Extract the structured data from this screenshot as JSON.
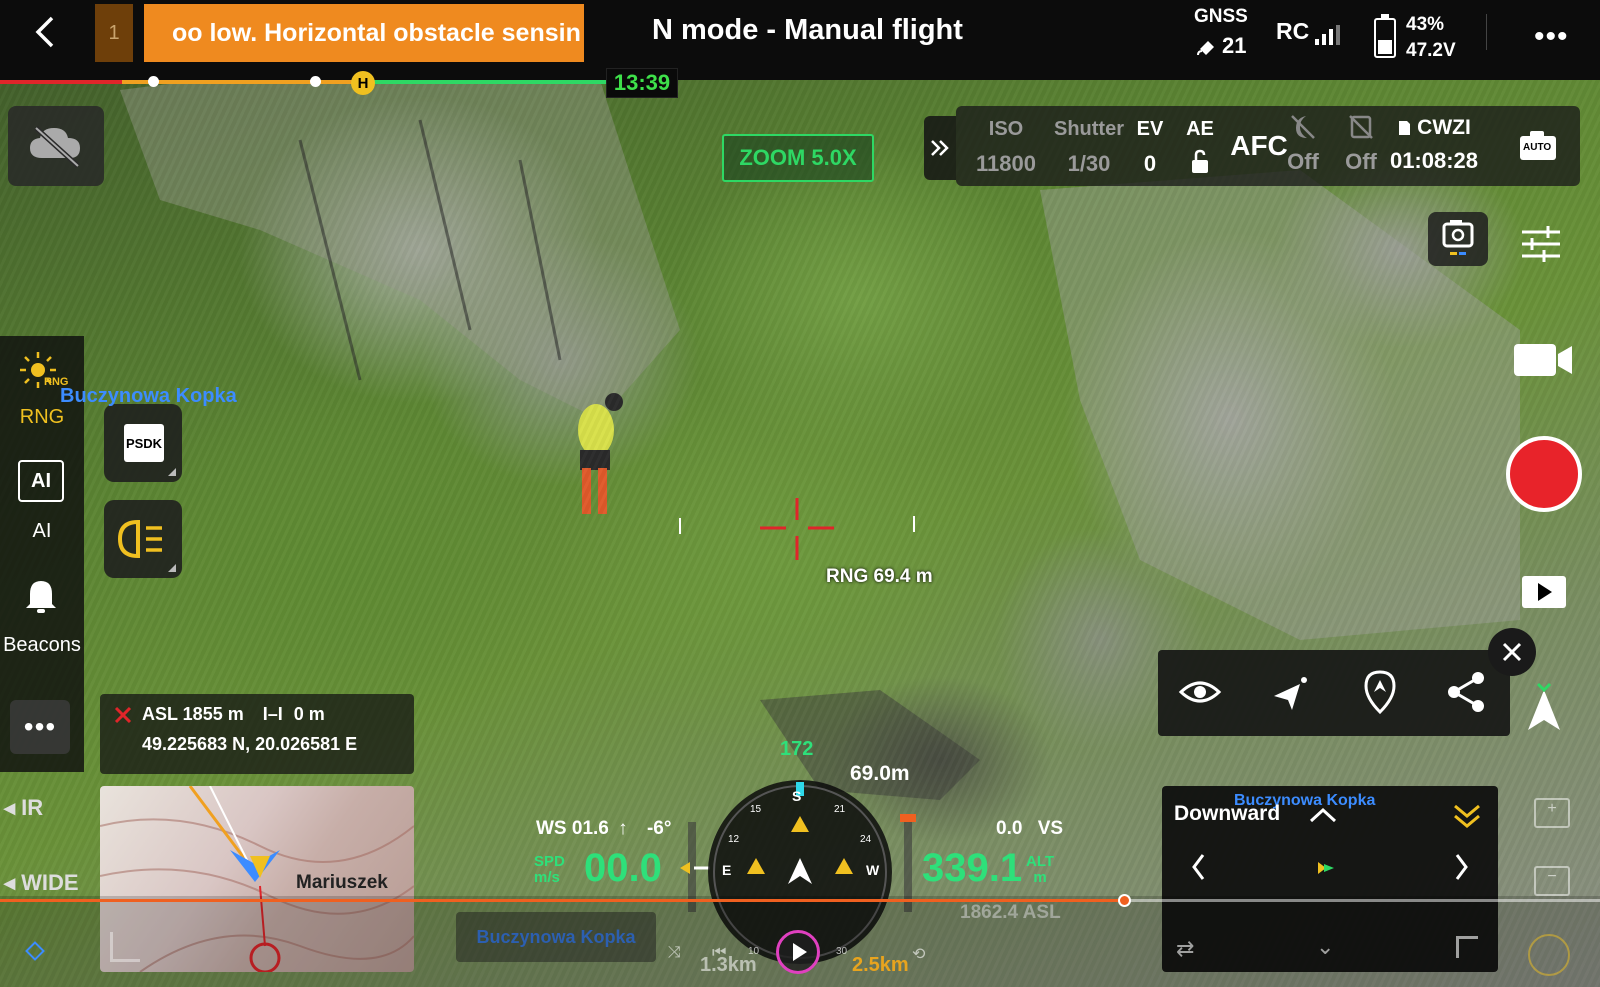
{
  "top_bar": {
    "alert_count": "1",
    "alert_text": "oo low. Horizontal obstacle sensin",
    "flight_mode": "N mode - Manual flight",
    "gnss_label": "GNSS",
    "gnss_satellites": "21",
    "rc_label": "RC",
    "battery_percent": "43%",
    "battery_voltage": "47.2V",
    "more_label": "•••",
    "flight_time": "13:39",
    "home_marker": "H"
  },
  "left_rail": {
    "rng_label": "RNG",
    "rng_icon_text": "RNG",
    "ai_icon_text": "AI",
    "ai_label": "AI",
    "beacons_label": "Beacons",
    "more_label": "•••",
    "psdk_label": "PSDK",
    "lens_ir": "IR",
    "lens_wide": "WIDE"
  },
  "map_overlay": {
    "poi_label": "Buczynowa Kopka",
    "poi_name": "Mariuszek"
  },
  "camera_params": {
    "zoom": "ZOOM  5.0X",
    "iso_label": "ISO",
    "iso_value": "11800",
    "shutter_label": "Shutter",
    "shutter_value": "1/30",
    "ev_label": "EV",
    "ev_value": "0",
    "ae_label": "AE",
    "focus_mode": "AFC",
    "param_off_1": "Off",
    "param_off_2": "Off",
    "storage_label": "CWZI",
    "storage_remaining": "01:08:28",
    "auto_label": "AUTO"
  },
  "target": {
    "range": "RNG 69.4 m"
  },
  "location": {
    "asl": "ASL 1855 m",
    "rel_height": "0 m",
    "coords": "49.225683 N, 20.026581 E"
  },
  "instruments": {
    "heading": "172",
    "distance": "69.0m",
    "wind": "WS 01.6",
    "pitch": "-6°",
    "speed_label_1": "SPD",
    "speed_label_2": "m/s",
    "speed": "00.0",
    "vs_value": "0.0",
    "vs_label": "VS",
    "altitude": "339.1",
    "alt_label_1": "ALT",
    "alt_label_2": "m",
    "asl_readout": "1862.4 ASL",
    "compass_s": "S",
    "compass_e": "E",
    "compass_w": "W",
    "tick_15": "15",
    "tick_21": "21",
    "tick_12": "12",
    "tick_24": "24"
  },
  "downward": {
    "label": "Downward",
    "poi_label": "Buczynowa Kopka"
  },
  "playback": {
    "poi_label": "Buczynowa Kopka",
    "dist_left": "1.3km",
    "dist_right": "2.5km",
    "skip_back": "10",
    "skip_fwd": "30"
  },
  "colors": {
    "alert": "#ef8a1f",
    "hud_green": "#2ee07a",
    "record": "#e8232a",
    "poi_blue": "#3c8cff",
    "warning_yellow": "#f0c020"
  }
}
